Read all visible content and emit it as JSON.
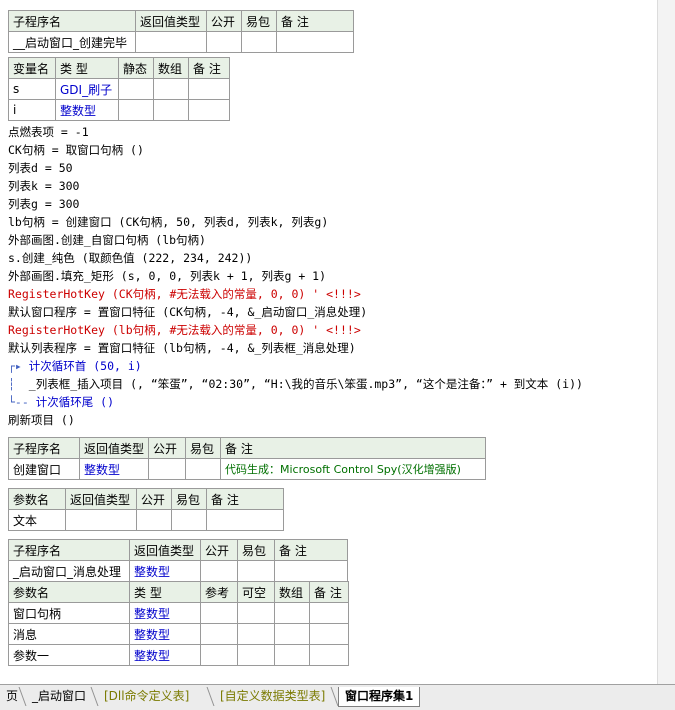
{
  "sub1": {
    "headers": [
      "子程序名",
      "返回值类型",
      "公开",
      "易包",
      "备 注"
    ],
    "row": [
      "__启动窗口_创建完毕",
      "",
      "",
      "",
      ""
    ]
  },
  "vars": {
    "headers": [
      "变量名",
      "类 型",
      "静态",
      "数组",
      "备 注"
    ],
    "rows": [
      [
        "s",
        "GDI_刷子",
        "",
        "",
        ""
      ],
      [
        "i",
        "整数型",
        "",
        "",
        ""
      ]
    ]
  },
  "code": [
    "点燃表项 = -1",
    "CK句柄 = 取窗口句柄 ()",
    "列表d = 50",
    "列表k = 300",
    "列表g = 300",
    "lb句柄 = 创建窗口 (CK句柄, 50, 列表d, 列表k, 列表g)",
    "外部画图.创建_自窗口句柄 (lb句柄)",
    "s.创建_纯色 (取颜色值 (222, 234, 242))",
    "外部画图.填充_矩形 (s, 0, 0, 列表k + 1, 列表g + 1)",
    "RegisterHotKey (CK句柄, #无法载入的常量, 0, 0) ' <!!!>",
    "默认窗口程序 = 置窗口特征 (CK句柄, -4, &_启动窗口_消息处理)",
    "RegisterHotKey (lb句柄, #无法载入的常量, 0, 0) ' <!!!>",
    "默认列表程序 = 置窗口特征 (lb句柄, -4, &_列表框_消息处理)"
  ],
  "loop": {
    "head": "计次循环首 (50, i)",
    "body": "_列表框_插入项目 (, “笨蛋”, “02:30”, “H:\\我的音乐\\笨蛋.mp3”, “这个是注备：” + 到文本 (i))",
    "tail": "计次循环尾 ()"
  },
  "after_loop": "刷新项目 ()",
  "sub2": {
    "headers": [
      "子程序名",
      "返回值类型",
      "公开",
      "易包",
      "备 注"
    ],
    "row": [
      "创建窗口",
      "整数型",
      "",
      "",
      "代码生成：Microsoft Control Spy(汉化增强版)"
    ]
  },
  "params2": {
    "headers": [
      "参数名",
      "返回值类型",
      "公开",
      "易包",
      "备 注"
    ],
    "row": [
      "文本",
      "",
      "",
      "",
      ""
    ]
  },
  "sub3": {
    "headers": [
      "子程序名",
      "返回值类型",
      "公开",
      "易包",
      "备 注"
    ],
    "row": [
      "_启动窗口_消息处理",
      "整数型",
      "",
      "",
      ""
    ]
  },
  "params3": {
    "headers": [
      "参数名",
      "类 型",
      "参考",
      "可空",
      "数组",
      "备 注"
    ],
    "rows": [
      [
        "窗口句柄",
        "整数型",
        "",
        "",
        "",
        ""
      ],
      [
        "消息",
        "整数型",
        "",
        "",
        "",
        ""
      ],
      [
        "参数一",
        "整数型",
        "",
        "",
        "",
        ""
      ]
    ]
  },
  "tabs": [
    "页",
    "_启动窗口",
    "[Dll命令定义表]",
    "[自定义数据类型表]",
    "窗口程序集1"
  ]
}
